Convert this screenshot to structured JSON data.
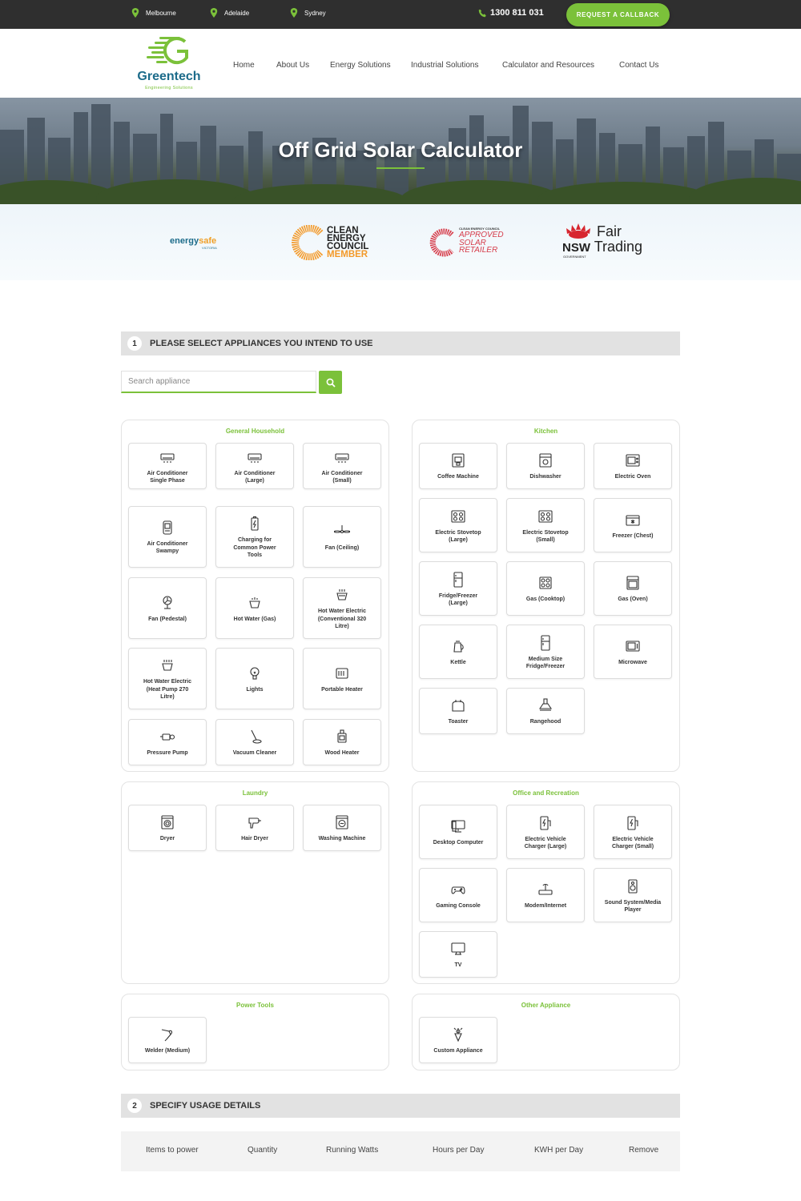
{
  "topbar": {
    "locations": [
      "Melbourne",
      "Adelaide",
      "Sydney"
    ],
    "phone": "1300 811 031",
    "callback_label": "REQUEST A CALLBACK"
  },
  "header": {
    "logo_name": "Greentech",
    "logo_sub": "Engineering Solutions",
    "nav": [
      "Home",
      "About Us",
      "Energy Solutions",
      "Industrial Solutions",
      "Calculator and Resources",
      "Contact Us"
    ]
  },
  "hero": {
    "title": "Off Grid Solar Calculator"
  },
  "accreditations": {
    "energysafe": {
      "main_a": "energy",
      "main_b": "safe",
      "sub": "VICTORIA"
    },
    "cec_member": {
      "l1": "CLEAN",
      "l2": "ENERGY",
      "l3": "COUNCIL",
      "l4": "MEMBER"
    },
    "cec_retailer": {
      "top": "CLEAN ENERGY COUNCIL",
      "l1": "APPROVED",
      "l2": "SOLAR",
      "l3": "RETAILER"
    },
    "nsw": {
      "l1": "Fair",
      "l2a": "NSW",
      "l2b": "Trading",
      "sub": "GOVERNMENT"
    }
  },
  "step1": {
    "num": "1",
    "title": "PLEASE SELECT APPLIANCES YOU INTEND TO USE",
    "search_placeholder": "Search appliance"
  },
  "panels": {
    "general": {
      "title": "General Household",
      "items": [
        {
          "label": "Air Conditioner\nSingle Phase",
          "icon": "air-conditioner-icon"
        },
        {
          "label": "Air Conditioner\n(Large)",
          "icon": "air-conditioner-icon"
        },
        {
          "label": "Air Conditioner\n(Small)",
          "icon": "air-conditioner-icon"
        },
        {
          "label": "Air Conditioner\nSwampy",
          "icon": "evaporative-cooler-icon"
        },
        {
          "label": "Charging for\nCommon Power\nTools",
          "icon": "battery-charge-icon"
        },
        {
          "label": "Fan (Ceiling)",
          "icon": "ceiling-fan-icon"
        },
        {
          "label": "Fan (Pedestal)",
          "icon": "pedestal-fan-icon"
        },
        {
          "label": "Hot Water (Gas)",
          "icon": "gas-hot-water-icon"
        },
        {
          "label": "Hot Water Electric\n(Conventional 320\nLitre)",
          "icon": "electric-hot-water-icon"
        },
        {
          "label": "Hot Water Electric\n(Heat Pump 270\nLitre)",
          "icon": "heat-pump-icon"
        },
        {
          "label": "Lights",
          "icon": "light-bulb-icon"
        },
        {
          "label": "Portable Heater",
          "icon": "portable-heater-icon"
        },
        {
          "label": "Pressure Pump",
          "icon": "pressure-pump-icon"
        },
        {
          "label": "Vacuum Cleaner",
          "icon": "vacuum-cleaner-icon"
        },
        {
          "label": "Wood Heater",
          "icon": "wood-heater-icon"
        }
      ]
    },
    "kitchen": {
      "title": "Kitchen",
      "items": [
        {
          "label": "Coffee Machine",
          "icon": "coffee-machine-icon"
        },
        {
          "label": "Dishwasher",
          "icon": "dishwasher-icon"
        },
        {
          "label": "Electric Oven",
          "icon": "electric-oven-icon"
        },
        {
          "label": "Electric Stovetop\n(Large)",
          "icon": "stovetop-icon"
        },
        {
          "label": "Electric Stovetop\n(Small)",
          "icon": "stovetop-icon"
        },
        {
          "label": "Freezer (Chest)",
          "icon": "chest-freezer-icon"
        },
        {
          "label": "Fridge/Freezer\n(Large)",
          "icon": "fridge-icon"
        },
        {
          "label": "Gas (Cooktop)",
          "icon": "gas-cooktop-icon"
        },
        {
          "label": "Gas (Oven)",
          "icon": "gas-oven-icon"
        },
        {
          "label": "Kettle",
          "icon": "kettle-icon"
        },
        {
          "label": "Medium Size\nFridge/Freezer",
          "icon": "fridge-icon"
        },
        {
          "label": "Microwave",
          "icon": "microwave-icon"
        },
        {
          "label": "Toaster",
          "icon": "toaster-icon"
        },
        {
          "label": "Rangehood",
          "icon": "rangehood-icon"
        }
      ]
    },
    "laundry": {
      "title": "Laundry",
      "items": [
        {
          "label": "Dryer",
          "icon": "dryer-icon"
        },
        {
          "label": "Hair Dryer",
          "icon": "hair-dryer-icon"
        },
        {
          "label": "Washing Machine",
          "icon": "washing-machine-icon"
        }
      ]
    },
    "office": {
      "title": "Office and Recreation",
      "items": [
        {
          "label": "Desktop Computer",
          "icon": "desktop-computer-icon"
        },
        {
          "label": "Electric Vehicle\nCharger (Large)",
          "icon": "ev-charger-icon"
        },
        {
          "label": "Electric Vehicle\nCharger (Small)",
          "icon": "ev-charger-icon"
        },
        {
          "label": "Gaming Console",
          "icon": "gamepad-icon"
        },
        {
          "label": "Modem/Internet",
          "icon": "modem-icon"
        },
        {
          "label": "Sound System/Media\nPlayer",
          "icon": "speaker-icon"
        },
        {
          "label": "TV",
          "icon": "tv-icon"
        }
      ]
    },
    "power_tools": {
      "title": "Power Tools",
      "items": [
        {
          "label": "Welder (Medium)",
          "icon": "welder-icon"
        }
      ]
    },
    "other": {
      "title": "Other Appliance",
      "items": [
        {
          "label": "Custom Appliance",
          "icon": "custom-appliance-icon"
        }
      ]
    }
  },
  "step2": {
    "num": "2",
    "title": "SPECIFY USAGE DETAILS",
    "columns": [
      "Items to power",
      "Quantity",
      "Running Watts",
      "Hours per Day",
      "KWH per Day",
      "Remove"
    ]
  },
  "colors": {
    "accent": "#7bc13a",
    "topbar": "#2f2f2f",
    "logo_blue": "#1c6b8a"
  }
}
